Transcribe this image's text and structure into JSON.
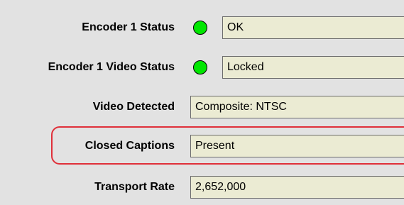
{
  "rows": [
    {
      "label": "Encoder 1 Status",
      "value": "OK",
      "led": "green"
    },
    {
      "label": "Encoder 1 Video Status",
      "value": "Locked",
      "led": "green"
    },
    {
      "label": "Video Detected",
      "value": "Composite: NTSC"
    },
    {
      "label": "Closed Captions",
      "value": "Present"
    },
    {
      "label": "Transport Rate",
      "value": "2,652,000"
    }
  ],
  "colors": {
    "led_on": "#00e600",
    "highlight": "#e0303a",
    "field_bg": "#ebebd3"
  }
}
